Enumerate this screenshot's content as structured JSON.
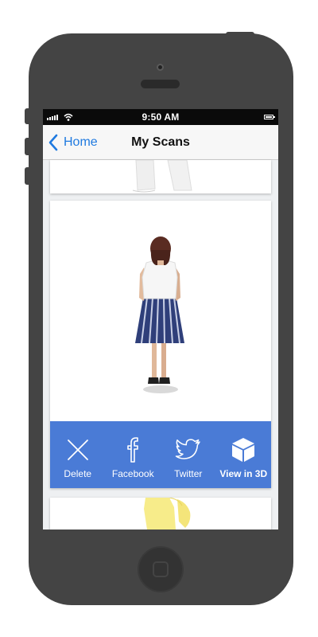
{
  "status_bar": {
    "time": "9:50 AM"
  },
  "nav": {
    "back_label": "Home",
    "title": "My Scans"
  },
  "colors": {
    "accent": "#1f7ae0",
    "action_bar": "#4a7bd6",
    "phone_body": "#444444"
  },
  "scan_card": {
    "actions": [
      {
        "label": "Delete",
        "icon": "close-icon"
      },
      {
        "label": "Facebook",
        "icon": "facebook-icon"
      },
      {
        "label": "Twitter",
        "icon": "twitter-icon"
      },
      {
        "label": "View in 3D",
        "icon": "cube-icon"
      }
    ]
  }
}
